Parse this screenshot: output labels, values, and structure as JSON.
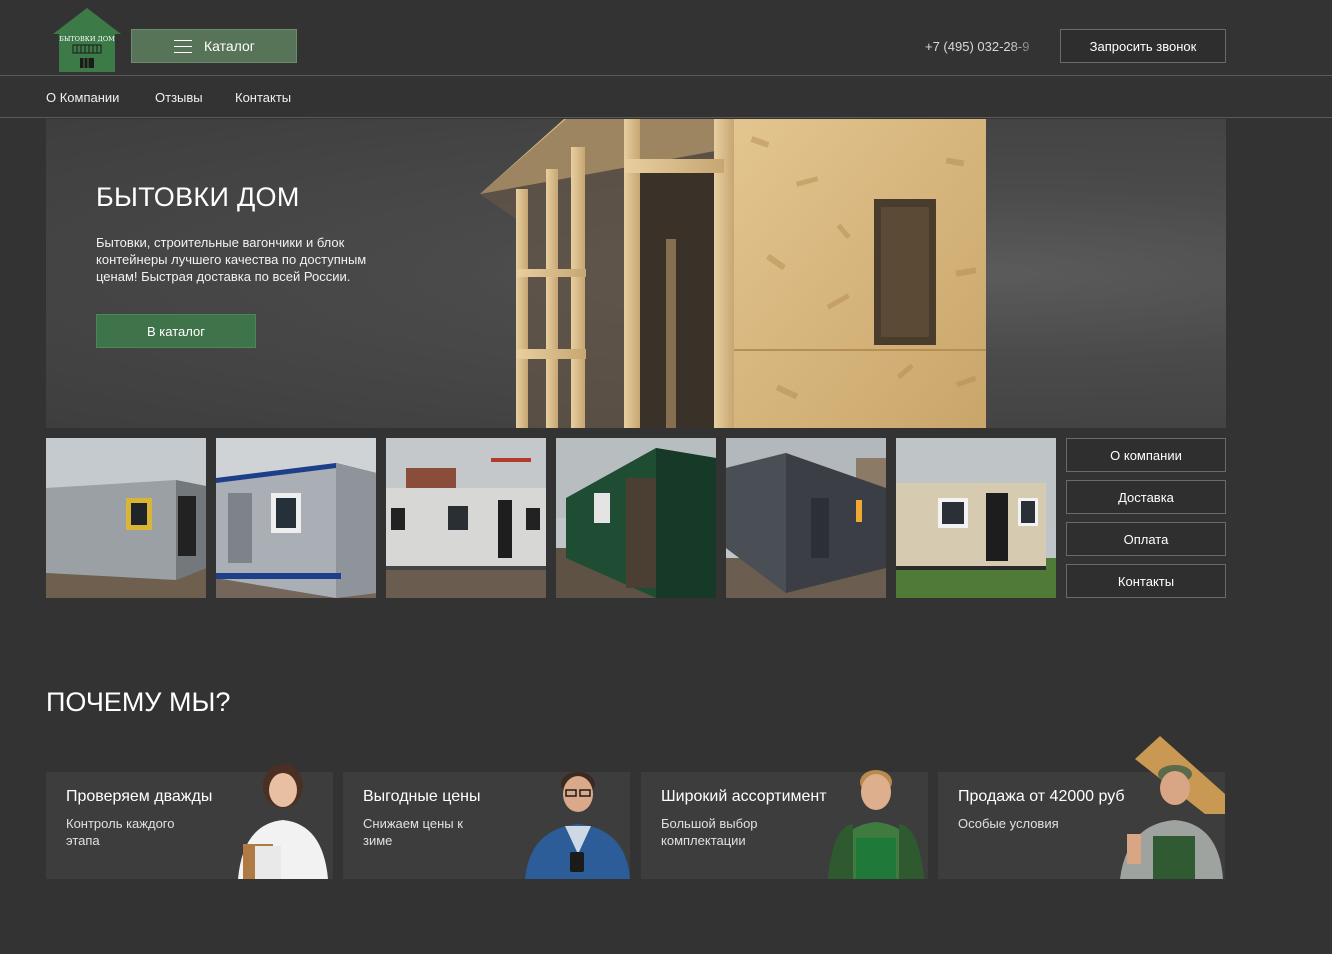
{
  "header": {
    "logo_text": "БЫТОВКИ ДОМ",
    "catalog_label": "Каталог",
    "phone": "+7 (495) 032-28-9",
    "callback_label": "Запросить звонок"
  },
  "nav": {
    "items": [
      {
        "label": "О Компании"
      },
      {
        "label": "Отзывы"
      },
      {
        "label": "Контакты"
      }
    ]
  },
  "hero": {
    "title": "БЫТОВКИ ДОМ",
    "description": "Бытовки, строительные вагончики и блок контейнеры лучшего качества по доступным ценам! Быстрая доставка по всей России.",
    "button_label": "В каталог"
  },
  "thumbnails": [
    {
      "name": "container-gray",
      "color": "#9aa0a4"
    },
    {
      "name": "container-silver-blue",
      "color": "#a9afb4"
    },
    {
      "name": "container-white",
      "color": "#d7d7d5"
    },
    {
      "name": "container-green",
      "color": "#1f4d34"
    },
    {
      "name": "container-dark",
      "color": "#3b3f45"
    },
    {
      "name": "container-beige",
      "color": "#d6cbb0"
    }
  ],
  "side_menu": [
    {
      "label": "О компании"
    },
    {
      "label": "Доставка"
    },
    {
      "label": "Оплата"
    },
    {
      "label": "Контакты"
    }
  ],
  "why": {
    "title": "ПОЧЕМУ МЫ?",
    "cards": [
      {
        "title": "Проверяем дважды",
        "text": "Контроль каждого этапа"
      },
      {
        "title": "Выгодные цены",
        "text": "Снижаем цены к зиме"
      },
      {
        "title": "Широкий ассортимент",
        "text": "Большой выбор комплектации"
      },
      {
        "title": "Продажа от 42000 руб",
        "text": "Особые условия"
      }
    ]
  },
  "colors": {
    "background": "#333333",
    "accent_green": "#3f7349",
    "catalog_green": "#577358"
  }
}
